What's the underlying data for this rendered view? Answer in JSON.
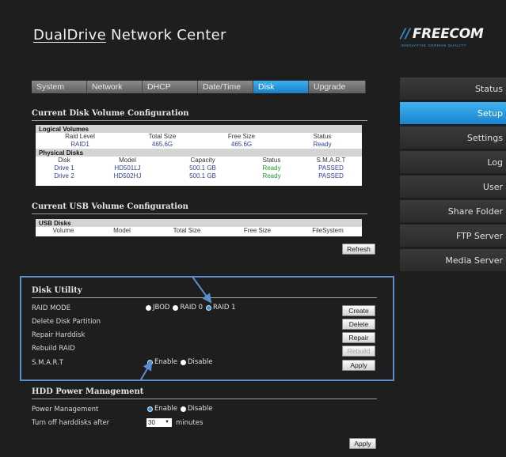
{
  "header": {
    "title_under": "DualDrive",
    "title_rest": " Network Center"
  },
  "logo": {
    "slashes": "//",
    "name": "FREECOM",
    "tagline": "INNOVATIVE GERMAN QUALITY"
  },
  "tabs": [
    "System",
    "Network",
    "DHCP",
    "Date/Time",
    "Disk",
    "Upgrade"
  ],
  "sidebar": [
    "Status",
    "Setup",
    "Settings",
    "Log",
    "User",
    "Share Folder",
    "FTP Server",
    "Media Server"
  ],
  "disk_volume": {
    "title": "Current Disk Volume Configuration",
    "logical_title": "Logical Volumes",
    "logical_headers": [
      "Raid Level",
      "Total Size",
      "Free Size",
      "Status"
    ],
    "logical_row": [
      "RAID1",
      "465.6G",
      "465.6G",
      "Ready"
    ],
    "physical_title": "Physical Disks",
    "physical_headers": [
      "Disk",
      "Model",
      "Capacity",
      "Status",
      "S.M.A.R.T"
    ],
    "physical_rows": [
      [
        "Drive 1",
        "HD501LJ",
        "500.1 GB",
        "Ready",
        "PASSED"
      ],
      [
        "Drive 2",
        "HD502HJ",
        "500.1 GB",
        "Ready",
        "PASSED"
      ]
    ]
  },
  "usb_volume": {
    "title": "Current USB Volume Configuration",
    "usb_title": "USB Disks",
    "headers": [
      "Volume",
      "Model",
      "Total Size",
      "Free Size",
      "FileSystem"
    ],
    "refresh": "Refresh"
  },
  "disk_utility": {
    "title": "Disk Utility",
    "raid_mode_label": "RAID MODE",
    "raid_options": [
      "JBOD",
      "RAID 0",
      "RAID 1"
    ],
    "delete_label": "Delete Disk Partition",
    "repair_label": "Repair Harddisk",
    "rebuild_label": "Rebuild RAID",
    "smart_label": "S.M.A.R.T",
    "smart_options": [
      "Enable",
      "Disable"
    ],
    "buttons": {
      "create": "Create",
      "delete": "Delete",
      "repair": "Repair",
      "rebuild": "Rebuild",
      "apply": "Apply"
    }
  },
  "power": {
    "title": "HDD Power Management",
    "pm_label": "Power Management",
    "pm_options": [
      "Enable",
      "Disable"
    ],
    "turnoff_label": "Turn off harddisks after",
    "minutes_value": "30",
    "minutes_unit": "minutes",
    "apply": "Apply"
  },
  "colors": {
    "accent": "#1a84cf",
    "highlight_box": "#5b8fd0"
  }
}
